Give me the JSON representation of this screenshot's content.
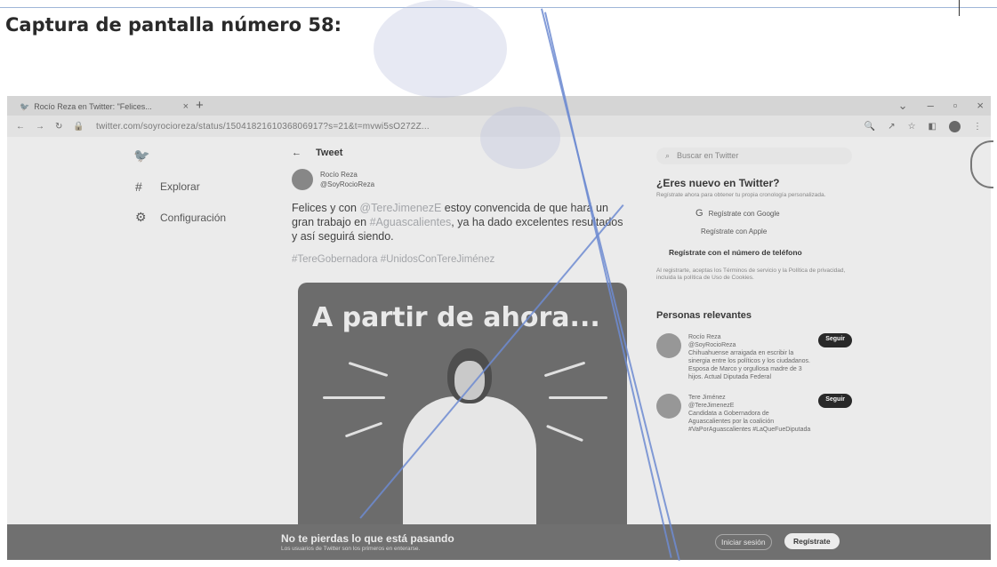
{
  "page_heading": "Captura de pantalla número 58:",
  "browser": {
    "tab_title": "Rocío Reza en Twitter: \"Felices...",
    "url": "twitter.com/soyrocioreza/status/1504182161036806917?s=21&t=mvwi5sO272Z..."
  },
  "leftnav": {
    "items": [
      {
        "icon": "hash-icon",
        "glyph": "#",
        "label": "Explorar"
      },
      {
        "icon": "gear-icon",
        "glyph": "⚙",
        "label": "Configuración"
      }
    ]
  },
  "tweet": {
    "header": "Tweet",
    "author_name": "Rocío Reza",
    "author_handle": "@SoyRocioReza",
    "text_1": "Felices y con ",
    "mention": "@TereJimenezE",
    "text_2": " estoy convencida de que hará un gran trabajo en ",
    "place": "#Aguascalientes",
    "text_3": ", ya ha dado excelentes resultados y así seguirá siendo.",
    "hashtags": "#TereGobernadora #UnidosConTereJiménez",
    "image_headline": "A partir de ahora..."
  },
  "sidebar": {
    "search_placeholder": "Buscar en Twitter",
    "new_title": "¿Eres nuevo en Twitter?",
    "new_sub": "Regístrate ahora para obtener tu propia cronología personalizada.",
    "google_label": "Regístrate con Google",
    "apple_label": "Regístrate con Apple",
    "phone_label": "Regístrate con el número de teléfono",
    "terms": "Al registrarte, aceptas los Términos de servicio y la Política de privacidad, incluida la política de Uso de Cookies.",
    "relevant_title": "Personas relevantes",
    "profiles": [
      {
        "name": "Rocío Reza",
        "handle": "@SoyRocioReza",
        "bio": "Chihuahuense arraigada en escribir la sinergia entre los políticos y los ciudadanos. Esposa de Marco y orgullosa madre de 3 hijos. Actual Diputada Federal",
        "follow": "Seguir"
      },
      {
        "name": "Tere Jiménez",
        "handle": "@TereJimenezE",
        "bio": "Candidata a Gobernadora de Aguascalientes por la coalición #VaPorAguascalientes #LaQueFueDiputada",
        "follow": "Seguir"
      }
    ]
  },
  "banner": {
    "title": "No te pierdas lo que está pasando",
    "sub": "Los usuarios de Twitter son los primeros en enterarse.",
    "login": "Iniciar sesión",
    "signup": "Regístrate"
  }
}
